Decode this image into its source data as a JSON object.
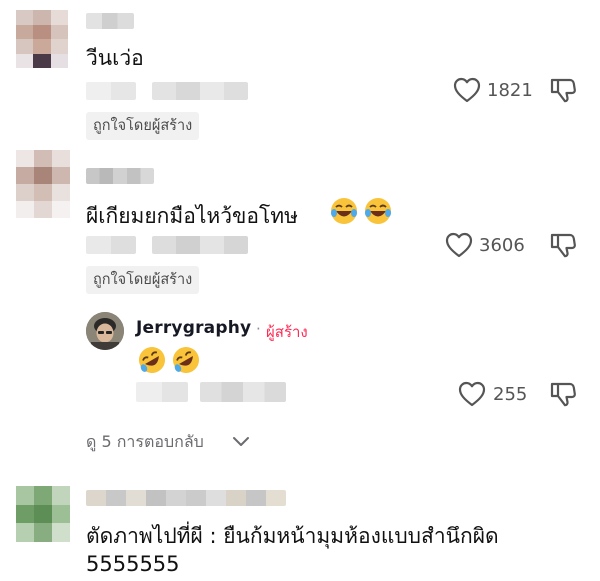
{
  "comments": [
    {
      "text": "วีนเว่อ",
      "like_count": "1821",
      "liked_by_creator": "ถูกใจโดยผู้สร้าง"
    },
    {
      "text": "ผีเกียมยกมือไหว้ขอโทษ",
      "like_count": "3606",
      "liked_by_creator": "ถูกใจโดยผู้สร้าง",
      "emoji": [
        "face-with-tears-of-joy",
        "face-with-tears-of-joy"
      ],
      "reply": {
        "username": "Jerrygraphy",
        "separator": "·",
        "creator_label": "ผู้สร้าง",
        "emoji": [
          "rolling-on-floor-laughing",
          "rolling-on-floor-laughing"
        ],
        "like_count": "255"
      },
      "view_replies": "ดู 5 การตอบกลับ"
    },
    {
      "text_line1": "ตัดภาพไปที่ผี : ยืนก้มหน้ามุมห้องแบบสำนึกผิด",
      "text_line2": "5555555"
    }
  ],
  "colors": {
    "text": "#161823",
    "creator_accent": "#fe2c55",
    "muted": "#6b6b70",
    "badge_bg": "#f1f1f2",
    "emoji_yellow": "#f9c33a"
  },
  "icons": [
    "heart-outline-icon",
    "thumb-down-icon",
    "chevron-down-icon"
  ]
}
